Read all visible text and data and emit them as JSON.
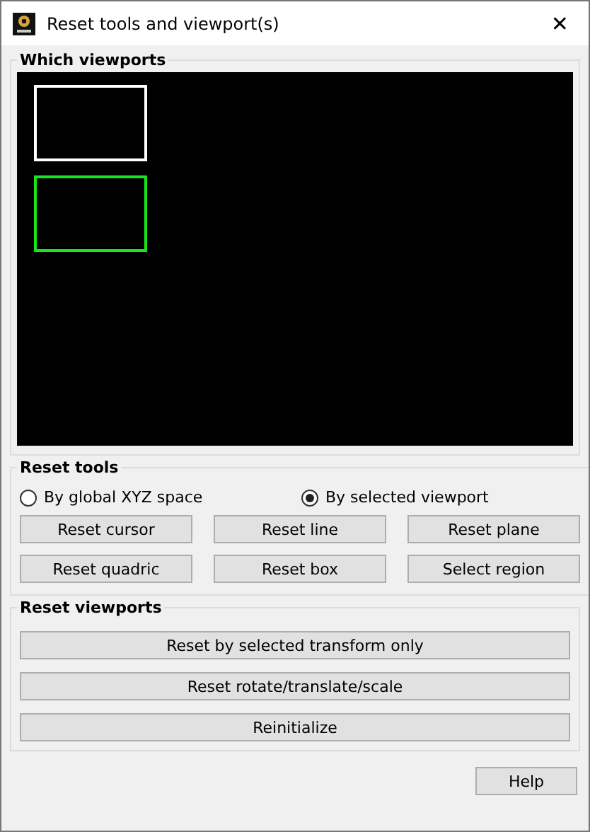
{
  "window": {
    "title": "Reset tools and viewport(s)",
    "close": "✕"
  },
  "viewports_group": {
    "title": "Which viewports",
    "viewports": [
      {
        "selected": false
      },
      {
        "selected": true
      }
    ]
  },
  "tools_group": {
    "title": "Reset tools",
    "modes": [
      {
        "label": "By global XYZ space",
        "selected": false
      },
      {
        "label": "By selected viewport",
        "selected": true
      }
    ],
    "buttons": [
      "Reset cursor",
      "Reset line",
      "Reset plane",
      "Reset quadric",
      "Reset box",
      "Select region"
    ]
  },
  "viewports_reset_group": {
    "title": "Reset viewports",
    "buttons": [
      "Reset by selected transform only",
      "Reset rotate/translate/scale",
      "Reinitialize"
    ]
  },
  "help_button": "Help"
}
